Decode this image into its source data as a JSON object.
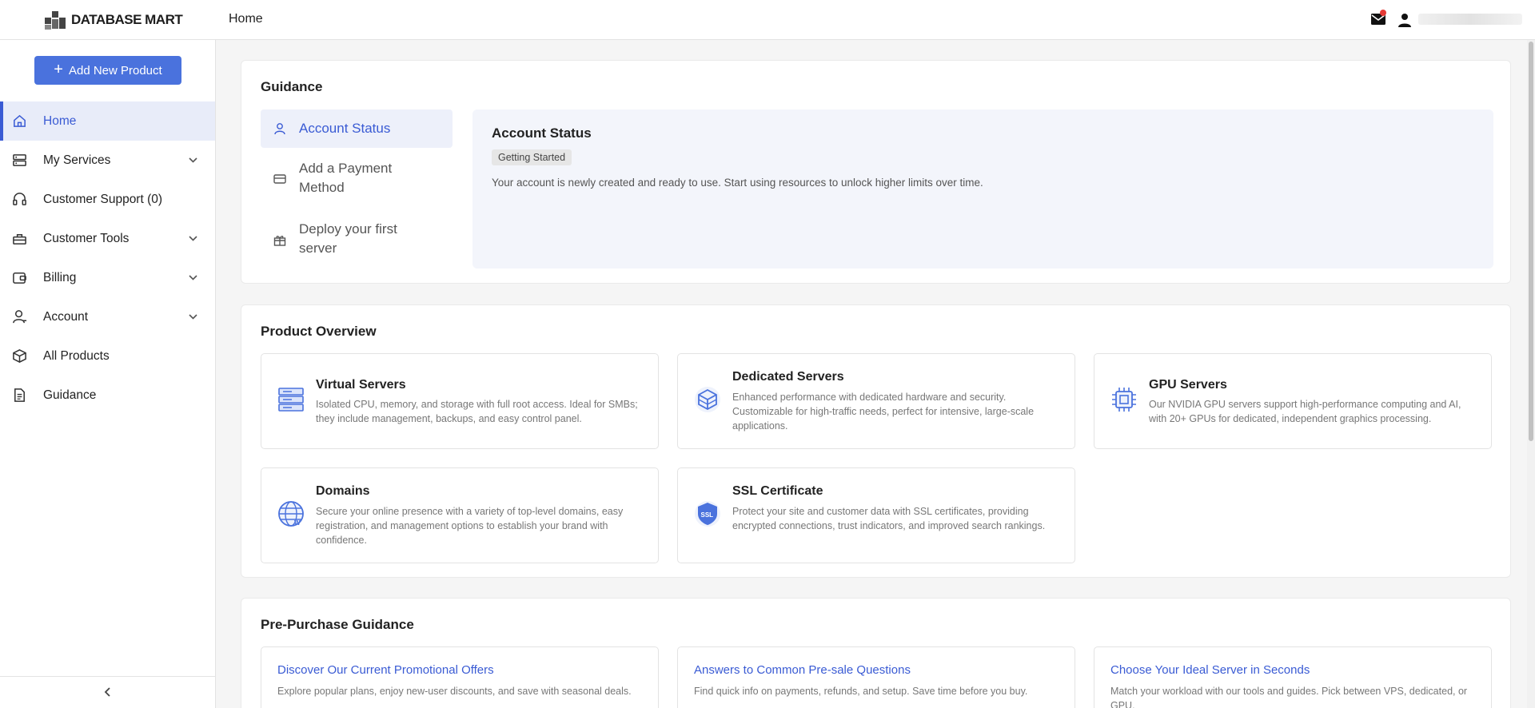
{
  "header": {
    "logo_text": "DATABASE MART",
    "title": "Home"
  },
  "sidebar": {
    "add_button": "Add New Product",
    "items": [
      {
        "label": "Home",
        "active": true,
        "expandable": false
      },
      {
        "label": "My Services",
        "expandable": true
      },
      {
        "label": "Customer Support (0)",
        "expandable": false
      },
      {
        "label": "Customer Tools",
        "expandable": true
      },
      {
        "label": "Billing",
        "expandable": true
      },
      {
        "label": "Account",
        "expandable": true
      },
      {
        "label": "All Products",
        "expandable": false
      },
      {
        "label": "Guidance",
        "expandable": false
      }
    ]
  },
  "guidance": {
    "title": "Guidance",
    "steps": [
      {
        "label": "Account Status",
        "active": true,
        "icon": "person-icon"
      },
      {
        "label": "Add a Payment Method",
        "icon": "credit-card-icon"
      },
      {
        "label": "Deploy your first server",
        "icon": "gift-icon"
      }
    ],
    "panel": {
      "title": "Account Status",
      "badge": "Getting Started",
      "description": "Your account is newly created and ready to use. Start using resources to unlock higher limits over time."
    }
  },
  "product_overview": {
    "title": "Product Overview",
    "products": [
      {
        "name": "Virtual Servers",
        "icon": "server-stack-icon",
        "description": "Isolated CPU, memory, and storage with full root access. Ideal for SMBs; they include management, backups, and easy control panel."
      },
      {
        "name": "Dedicated Servers",
        "icon": "cube-icon",
        "description": "Enhanced performance with dedicated hardware and security. Customizable for high-traffic needs, perfect for intensive, large-scale applications."
      },
      {
        "name": "GPU Servers",
        "icon": "chip-icon",
        "description": "Our NVIDIA GPU servers support high-performance computing and AI, with 20+ GPUs for dedicated, independent graphics processing."
      },
      {
        "name": "Domains",
        "icon": "globe-icon",
        "description": "Secure your online presence with a variety of top-level domains, easy registration, and management options to establish your brand with confidence."
      },
      {
        "name": "SSL Certificate",
        "icon": "ssl-shield-icon",
        "description": "Protect your site and customer data with SSL certificates, providing encrypted connections, trust indicators, and improved search rankings."
      }
    ]
  },
  "pre_purchase": {
    "title": "Pre-Purchase Guidance",
    "items": [
      {
        "title": "Discover Our Current Promotional Offers",
        "description": "Explore popular plans, enjoy new-user discounts, and save with seasonal deals."
      },
      {
        "title": "Answers to Common Pre-sale Questions",
        "description": "Find quick info on payments, refunds, and setup. Save time before you buy."
      },
      {
        "title": "Choose Your Ideal Server in Seconds",
        "description": "Match your workload with our tools and guides. Pick between VPS, dedicated, or GPU."
      }
    ]
  },
  "colors": {
    "accent": "#4a72dd",
    "active_text": "#3a5bd4",
    "active_bg": "#e8ecf9",
    "notification_dot": "#e53935"
  }
}
